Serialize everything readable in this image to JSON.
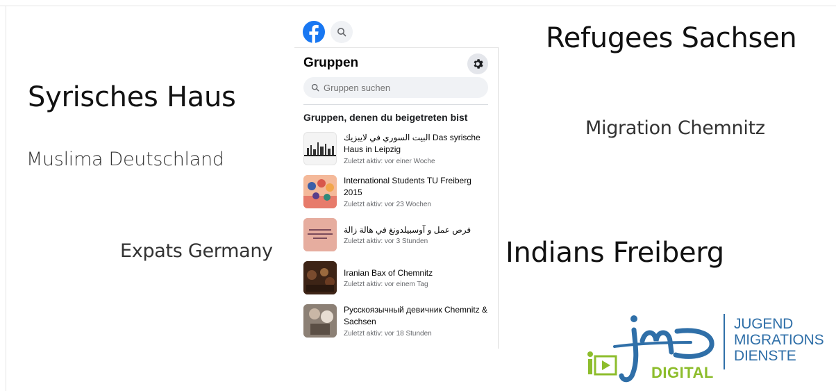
{
  "words": {
    "syrisches_haus": "Syrisches Haus",
    "muslima": "Muslima Deutschland",
    "expats": "Expats Germany",
    "refugees": "Refugees Sachsen",
    "migration": "Migration Chemnitz",
    "indians": "Indians Freiberg"
  },
  "facebook": {
    "logo_icon": "facebook-logo-icon",
    "search_icon": "search-icon",
    "groups_title": "Gruppen",
    "settings_icon": "gear-icon",
    "search_placeholder": "Gruppen suchen",
    "section_title": "Gruppen, denen du beigetreten bist",
    "groups": [
      {
        "name": "البيت السوري في لايبزيك Das syrische Haus in Leipzig",
        "meta": "Zuletzt aktiv: vor einer Woche"
      },
      {
        "name": "International Students TU Freiberg 2015",
        "meta": "Zuletzt aktiv: vor 23 Wochen"
      },
      {
        "name": "فرص عمل و آوسبيلدونغ في هالة زالة",
        "meta": "Zuletzt aktiv: vor 3 Stunden"
      },
      {
        "name": "Iranian Bax of Chemnitz",
        "meta": "Zuletzt aktiv: vor einem Tag"
      },
      {
        "name": "Русскоязычный девичник Chemnitz & Sachsen",
        "meta": "Zuletzt aktiv: vor 18 Stunden"
      }
    ]
  },
  "jmd_logo": {
    "mark": "jmd",
    "line1": "JUGEND",
    "line2": "MIGRATIONS",
    "line3": "DIENSTE",
    "digital": "DIGITAL",
    "brand_blue": "#2f6fa8",
    "brand_green": "#8dbd2c"
  },
  "colors": {
    "facebook_blue": "#1877f2"
  }
}
